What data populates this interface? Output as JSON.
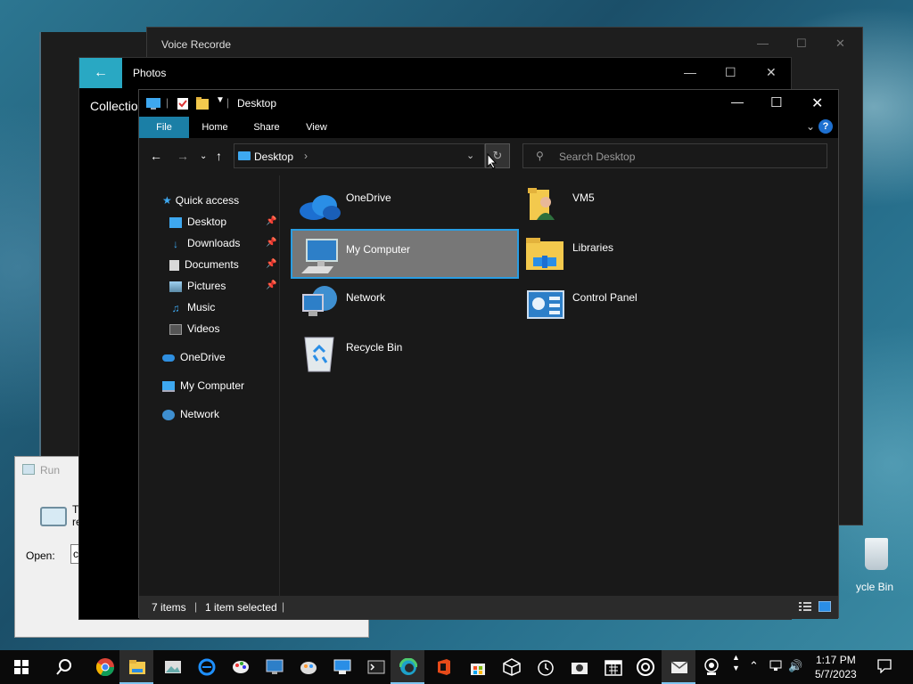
{
  "background_windows": {
    "voice_recorder": {
      "title": "Voice Recorde"
    },
    "photos": {
      "title": "Photos",
      "section": "Collection"
    },
    "run": {
      "title": "Run",
      "description_line1": "Ty",
      "description_line2": "re",
      "open_label": "Open:",
      "open_value": "c"
    },
    "desktop_recycle_label": "ycle Bin"
  },
  "explorer": {
    "title": "Desktop",
    "ribbon_tabs": [
      "File",
      "Home",
      "Share",
      "View"
    ],
    "address": {
      "location": "Desktop",
      "separator": "›"
    },
    "search": {
      "placeholder": "Search Desktop"
    },
    "nav_pane": {
      "quick_access": "Quick access",
      "pinned": [
        {
          "label": "Desktop",
          "pinned": true
        },
        {
          "label": "Downloads",
          "pinned": true
        },
        {
          "label": "Documents",
          "pinned": true
        },
        {
          "label": "Pictures",
          "pinned": true
        },
        {
          "label": "Music",
          "pinned": false
        },
        {
          "label": "Videos",
          "pinned": false
        }
      ],
      "onedrive": "OneDrive",
      "my_computer": "My Computer",
      "network": "Network"
    },
    "items": [
      {
        "label": "OneDrive",
        "icon": "onedrive-icon",
        "selected": false
      },
      {
        "label": "VM5",
        "icon": "user-folder-icon",
        "selected": false
      },
      {
        "label": "My Computer",
        "icon": "computer-icon",
        "selected": true
      },
      {
        "label": "Libraries",
        "icon": "libraries-icon",
        "selected": false
      },
      {
        "label": "Network",
        "icon": "network-icon",
        "selected": false
      },
      {
        "label": "Control Panel",
        "icon": "control-panel-icon",
        "selected": false
      },
      {
        "label": "Recycle Bin",
        "icon": "recycle-bin-icon",
        "selected": false
      }
    ],
    "status": {
      "count": "7 items",
      "selection": "1 item selected"
    }
  },
  "taskbar": {
    "time": "1:17 PM",
    "date": "5/7/2023",
    "pinned_apps": [
      "chrome-icon",
      "file-explorer-icon",
      "image-viewer-icon",
      "edge-legacy-icon",
      "paint-icon",
      "remote-desktop-icon",
      "paint3d-icon",
      "monitor-icon",
      "terminal-icon",
      "edge-icon",
      "office-icon",
      "store-icon",
      "3d-viewer-icon",
      "alarms-icon",
      "camera-icon",
      "calendar-icon",
      "groove-icon",
      "mail-icon",
      "webcam-icon"
    ]
  },
  "colors": {
    "accent": "#1b7fa6",
    "selection_border": "#2a9de2",
    "photos_accent": "#29a8c3"
  }
}
